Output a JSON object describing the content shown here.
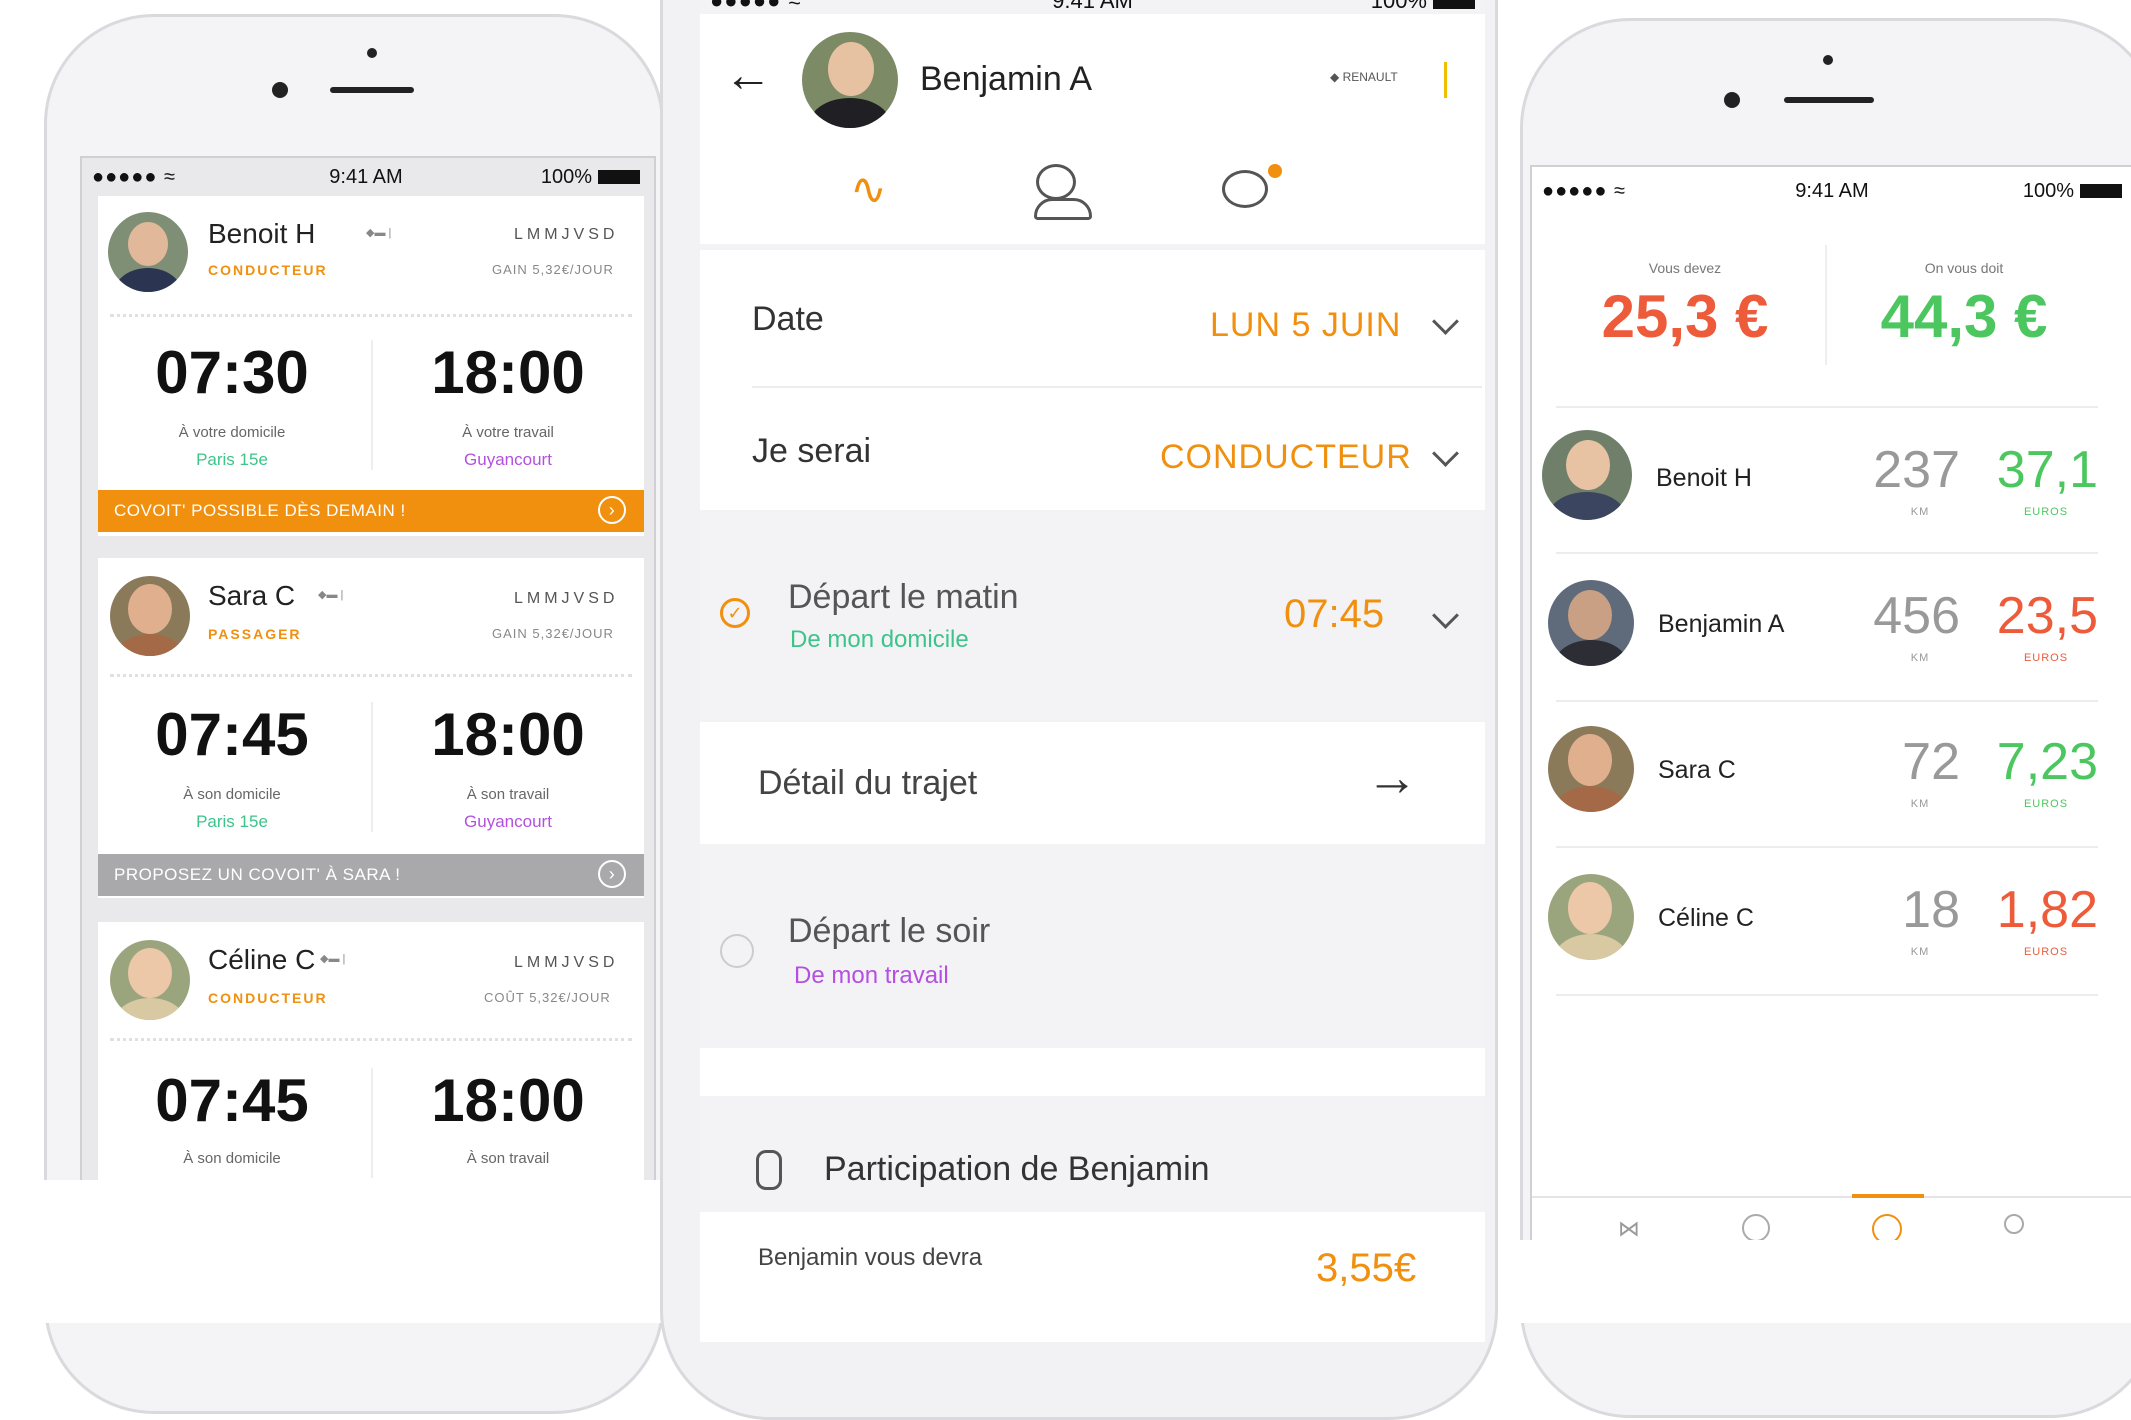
{
  "colors": {
    "orange": "#f0900e",
    "green": "#3cc48a",
    "purple": "#b44fe0",
    "red": "#ee5b3b",
    "eur_green": "#4cc760",
    "gray_banner": "#a9a9ac"
  },
  "left_phone": {
    "status": {
      "signal": "●●●●● ≈",
      "time": "9:41 AM",
      "battery": "100%"
    },
    "cards": [
      {
        "name": "Benoit H",
        "role": "CONDUCTEUR",
        "days": "LMMJVSD",
        "gain": "GAIN 5,32€/JOUR",
        "morning_time": "07:30",
        "morning_label": "À votre domicile",
        "morning_place": "Paris 15e",
        "evening_time": "18:00",
        "evening_label": "À votre travail",
        "evening_place": "Guyancourt",
        "banner": "COVOIT' POSSIBLE DÈS DEMAIN !"
      },
      {
        "name": "Sara C",
        "role": "PASSAGER",
        "days": "LMMJVSD",
        "gain": "GAIN 5,32€/JOUR",
        "morning_time": "07:45",
        "morning_label": "À son domicile",
        "morning_place": "Paris 15e",
        "evening_time": "18:00",
        "evening_label": "À son travail",
        "evening_place": "Guyancourt",
        "banner": "PROPOSEZ UN COVOIT' À SARA !"
      },
      {
        "name": "Céline C",
        "role": "CONDUCTEUR",
        "days": "LMMJVSD",
        "gain": "COÛT 5,32€/JOUR",
        "morning_time": "07:45",
        "morning_label": "À son domicile",
        "evening_time": "18:00",
        "evening_label": "À son travail"
      }
    ]
  },
  "middle_phone": {
    "status": {
      "signal": "●●●●● ≈",
      "time": "9:41 AM",
      "battery": "100%"
    },
    "header": {
      "name": "Benjamin A",
      "logo": "RENAULT"
    },
    "tabs": [
      "route-icon",
      "profile-icon",
      "chat-icon"
    ],
    "date_label": "Date",
    "date_value": "LUN 5 JUIN",
    "role_label": "Je serai",
    "role_value": "CONDUCTEUR",
    "morning": {
      "title": "Départ le matin",
      "sub": "De mon domicile",
      "time": "07:45"
    },
    "detail_label": "Détail du trajet",
    "evening": {
      "title": "Départ le soir",
      "sub": "De mon travail"
    },
    "participation_title": "Participation de Benjamin",
    "owed_label": "Benjamin vous devra",
    "owed_value": "3,55€"
  },
  "right_phone": {
    "status": {
      "signal": "●●●●● ≈",
      "time": "9:41 AM",
      "battery": "100%"
    },
    "you_owe_label": "Vous devez",
    "you_owe_value": "25,3 €",
    "owed_to_you_label": "On vous doit",
    "owed_to_you_value": "44,3 €",
    "people": [
      {
        "name": "Benoit H",
        "km": "237",
        "euros": "37,1",
        "positive": true
      },
      {
        "name": "Benjamin A",
        "km": "456",
        "euros": "23,5",
        "positive": false
      },
      {
        "name": "Sara C",
        "km": "72",
        "euros": "7,23",
        "positive": true
      },
      {
        "name": "Céline C",
        "km": "18",
        "euros": "1,82",
        "positive": false
      }
    ],
    "km_unit": "KM",
    "eur_unit": "EUROS"
  }
}
